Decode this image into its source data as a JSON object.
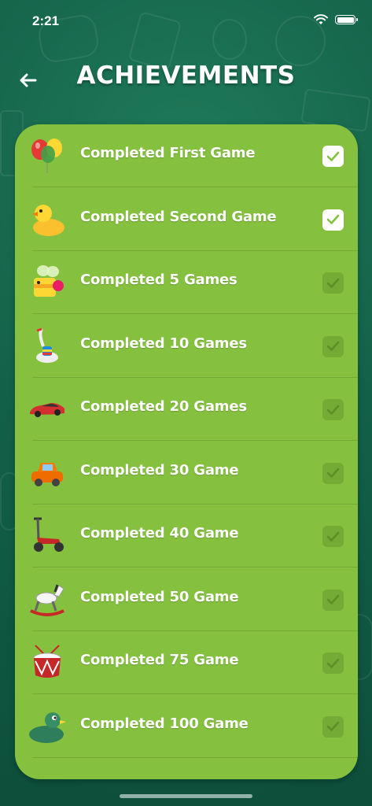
{
  "status_bar": {
    "time": "2:21"
  },
  "header": {
    "title": "ACHIEVEMENTS"
  },
  "achievements": [
    {
      "label": "Completed First Game",
      "icon": "balloons-icon",
      "checked": true
    },
    {
      "label": "Completed Second Game",
      "icon": "rubber-duck-icon",
      "checked": true
    },
    {
      "label": "Completed 5 Games",
      "icon": "toy-bee-icon",
      "checked": false
    },
    {
      "label": "Completed 10 Games",
      "icon": "toy-goose-icon",
      "checked": false
    },
    {
      "label": "Completed 20 Games",
      "icon": "red-sports-car-icon",
      "checked": false
    },
    {
      "label": "Completed 30 Game",
      "icon": "toy-car-icon",
      "checked": false
    },
    {
      "label": "Completed 40 Game",
      "icon": "scooter-icon",
      "checked": false
    },
    {
      "label": "Completed 50 Game",
      "icon": "rocking-horse-icon",
      "checked": false
    },
    {
      "label": "Completed 75 Game",
      "icon": "drum-icon",
      "checked": false
    },
    {
      "label": "Completed 100 Game",
      "icon": "green-duck-icon",
      "checked": false
    }
  ],
  "colors": {
    "card": "#85c13f",
    "background": "#136048",
    "check_on": "#ffffff",
    "check_off": "#74ab35"
  }
}
